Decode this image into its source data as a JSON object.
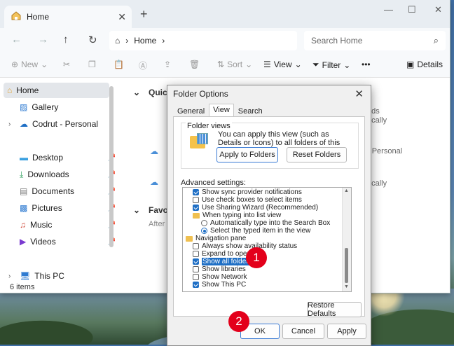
{
  "explorer": {
    "tab_title": "Home",
    "address_segment": "Home",
    "search_placeholder": "Search Home",
    "toolbar": {
      "new_label": "New",
      "sort_label": "Sort",
      "view_label": "View",
      "filter_label": "Filter",
      "more_label": "•••",
      "details_label": "Details"
    },
    "sidebar": {
      "items": [
        {
          "label": "Home"
        },
        {
          "label": "Gallery"
        },
        {
          "label": "Codrut - Personal"
        },
        {
          "label": "Desktop"
        },
        {
          "label": "Downloads"
        },
        {
          "label": "Documents"
        },
        {
          "label": "Pictures"
        },
        {
          "label": "Music"
        },
        {
          "label": "Videos"
        },
        {
          "label": "This PC"
        }
      ]
    },
    "main": {
      "quick_access": "Quick",
      "favorites": "Favorit",
      "favorites_hint": "After y",
      "right_texts": [
        "ads",
        "ocally",
        "- Personal",
        "ocally"
      ]
    },
    "status": "6 items"
  },
  "dialog": {
    "title": "Folder Options",
    "tabs": [
      "General",
      "View",
      "Search"
    ],
    "folder_views_title": "Folder views",
    "folder_views_desc": "You can apply this view (such as Details or Icons) to all folders of this type.",
    "apply_button": "Apply to Folders",
    "reset_button": "Reset Folders",
    "advanced_label": "Advanced settings:",
    "settings": [
      {
        "kind": "checkbox",
        "checked": true,
        "label": "Show sync provider notifications"
      },
      {
        "kind": "checkbox",
        "checked": false,
        "label": "Use check boxes to select items"
      },
      {
        "kind": "checkbox",
        "checked": true,
        "label": "Use Sharing Wizard (Recommended)"
      },
      {
        "kind": "group",
        "label": "When typing into list view"
      },
      {
        "kind": "radio",
        "checked": false,
        "label": "Automatically type into the Search Box"
      },
      {
        "kind": "radio",
        "checked": true,
        "label": "Select the typed item in the view"
      },
      {
        "kind": "group",
        "label": "Navigation pane"
      },
      {
        "kind": "checkbox",
        "checked": false,
        "label": "Always show availability status"
      },
      {
        "kind": "checkbox",
        "checked": false,
        "label": "Expand to open fo"
      },
      {
        "kind": "checkbox",
        "checked": true,
        "label": "Show all folders",
        "highlight": true
      },
      {
        "kind": "checkbox",
        "checked": false,
        "label": "Show libraries"
      },
      {
        "kind": "checkbox",
        "checked": false,
        "label": "Show Network"
      },
      {
        "kind": "checkbox",
        "checked": true,
        "label": "Show This PC"
      }
    ],
    "restore_button": "Restore Defaults",
    "ok_button": "OK",
    "cancel_button": "Cancel",
    "apply2_button": "Apply"
  },
  "annotations": {
    "step1": "1",
    "step2": "2"
  },
  "colors": {
    "accent": "#1f6fc5",
    "badge": "#e3001b"
  }
}
